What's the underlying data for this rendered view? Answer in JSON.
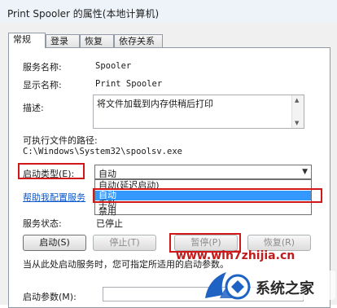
{
  "window": {
    "title": "Print Spooler 的属性(本地计算机)"
  },
  "tabs": [
    "常规",
    "登录",
    "恢复",
    "依存关系"
  ],
  "general": {
    "service_name_label": "服务名称:",
    "service_name_value": "Spooler",
    "display_name_label": "显示名称:",
    "display_name_value": "Print Spooler",
    "description_label": "描述:",
    "description_value": "将文件加载到内存供稍后打印",
    "exe_path_label": "可执行文件的路径:",
    "exe_path_value": "C:\\Windows\\System32\\spoolsv.exe",
    "startup_type_label": "启动类型(E):",
    "startup_type_value": "自动",
    "startup_options": [
      "自动(延迟启动)",
      "自动",
      "手动",
      "禁用"
    ],
    "selected_option_index": 1,
    "help_link": "帮助我配置服务",
    "service_status_label": "服务状态:",
    "service_status_value": "已停止",
    "buttons": {
      "start": "启动(S)",
      "stop": "停止(T)",
      "pause": "暂停(P)",
      "resume": "恢复(R)"
    },
    "note": "当从此处启动服务时，您可指定所适用的启动参数。",
    "start_params_label": "启动参数(M):",
    "start_params_value": ""
  },
  "watermark": {
    "url": "www.win7zhijia.cn",
    "logo_text": "系统之家"
  },
  "colors": {
    "highlight": "#3399ff",
    "annotation": "#d01818",
    "link": "#0b56c9"
  }
}
